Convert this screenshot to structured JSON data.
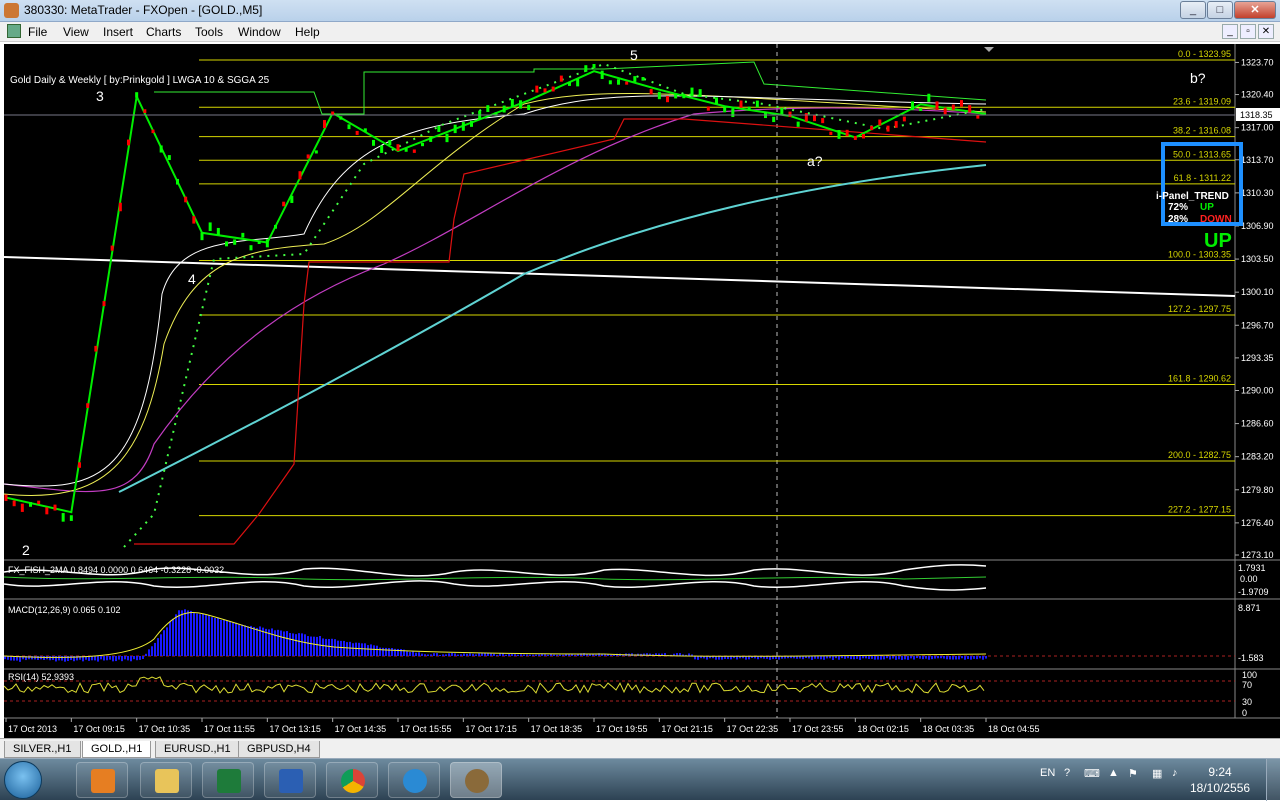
{
  "window": {
    "title": "380330: MetaTrader - FXOpen - [GOLD.,M5]",
    "controls": [
      "_",
      "□",
      "✕"
    ]
  },
  "menu": [
    "File",
    "View",
    "Insert",
    "Charts",
    "Tools",
    "Window",
    "Help"
  ],
  "mdi_controls": [
    "_",
    "▫",
    "✕"
  ],
  "chart": {
    "header": "Gold Daily & Weekly [ by:Prinkgold ] LWGA 10 & SGGA 25",
    "current_price": "1318.35",
    "price_labels": [
      "1323.70",
      "1320.40",
      "1317.00",
      "1313.70",
      "1310.30",
      "1306.90",
      "1303.50",
      "1300.10",
      "1296.70",
      "1293.35",
      "1290.00",
      "1286.60",
      "1283.20",
      "1279.80",
      "1276.40",
      "1273.10"
    ],
    "fib_levels": [
      {
        "label": "0.0 - 1323.95",
        "price": 1323.95
      },
      {
        "label": "23.6 - 1319.09",
        "price": 1319.09
      },
      {
        "label": "38.2 - 1316.08",
        "price": 1316.08
      },
      {
        "label": "50.0 - 1313.65",
        "price": 1313.65
      },
      {
        "label": "61.8 - 1311.22",
        "price": 1311.22
      },
      {
        "label": "100.0 - 1303.35",
        "price": 1303.35
      },
      {
        "label": "127.2 - 1297.75",
        "price": 1297.75
      },
      {
        "label": "161.8 - 1290.62",
        "price": 1290.62
      },
      {
        "label": "200.0 - 1282.75",
        "price": 1282.75
      },
      {
        "label": "227.2 - 1277.15",
        "price": 1277.15
      }
    ],
    "wave_labels": [
      "2",
      "3",
      "4",
      "5",
      "a?",
      "b?"
    ],
    "panel": {
      "title": "i-Panel_TREND",
      "row1": "72%",
      "row1b": "UP",
      "row2": "28%",
      "row2b": "DOWN",
      "signal": "UP"
    },
    "time_labels": [
      "17 Oct 2013",
      "17 Oct 09:15",
      "17 Oct 10:35",
      "17 Oct 11:55",
      "17 Oct 13:15",
      "17 Oct 14:35",
      "17 Oct 15:55",
      "17 Oct 17:15",
      "17 Oct 18:35",
      "17 Oct 19:55",
      "17 Oct 21:15",
      "17 Oct 22:35",
      "17 Oct 23:55",
      "18 Oct 02:15",
      "18 Oct 03:35",
      "18 Oct 04:55"
    ],
    "fish": {
      "label": "FX_FISH_2MA 0.8494 0.0000 0.6464 -0.3228 -0.0032",
      "scale": [
        "1.7931",
        "0.00",
        "-1.9709"
      ]
    },
    "macd": {
      "label": "MACD(12,26,9) 0.065 0.102",
      "scale": [
        "8.871",
        "-1.583"
      ]
    },
    "rsi": {
      "label": "RSI(14) 52.9393",
      "scale": [
        "100",
        "70",
        "30",
        "0"
      ]
    },
    "colors": {
      "bull": "#00ff00",
      "bear": "#ff0000",
      "ma_slow": "#5fd3d3",
      "ma_mid": "#c23dc2",
      "fib": "#d6d600",
      "panel_border": "#1e90ff",
      "macd_hist": "#1a1aff"
    }
  },
  "chart_data": {
    "type": "line",
    "x": [
      "17 Oct 2013",
      "17 Oct 09:15",
      "17 Oct 10:35",
      "17 Oct 11:55",
      "17 Oct 13:15",
      "17 Oct 14:35",
      "17 Oct 15:55",
      "17 Oct 17:15",
      "17 Oct 18:35",
      "17 Oct 19:55",
      "17 Oct 21:15",
      "17 Oct 22:35",
      "17 Oct 23:55",
      "18 Oct 02:15",
      "18 Oct 03:35",
      "18 Oct 04:55"
    ],
    "series": [
      {
        "values": [
          1279.0,
          1277.5,
          1320.2,
          1306.2,
          1305.2,
          1318.5,
          1314.6,
          1317.2,
          1319.8,
          1322.8,
          1320.9,
          1319.2,
          1318.2,
          1316.0,
          1319.4,
          1318.4
        ]
      }
    ],
    "ylim": [
      1271.5,
      1325.3
    ]
  },
  "tabs": [
    "SILVER.,H1",
    "GOLD.,H1",
    "EURUSD.,H1",
    "GBPUSD,H4"
  ],
  "taskbar": {
    "language": "EN",
    "time": "9:24",
    "date": "18/10/2556"
  }
}
